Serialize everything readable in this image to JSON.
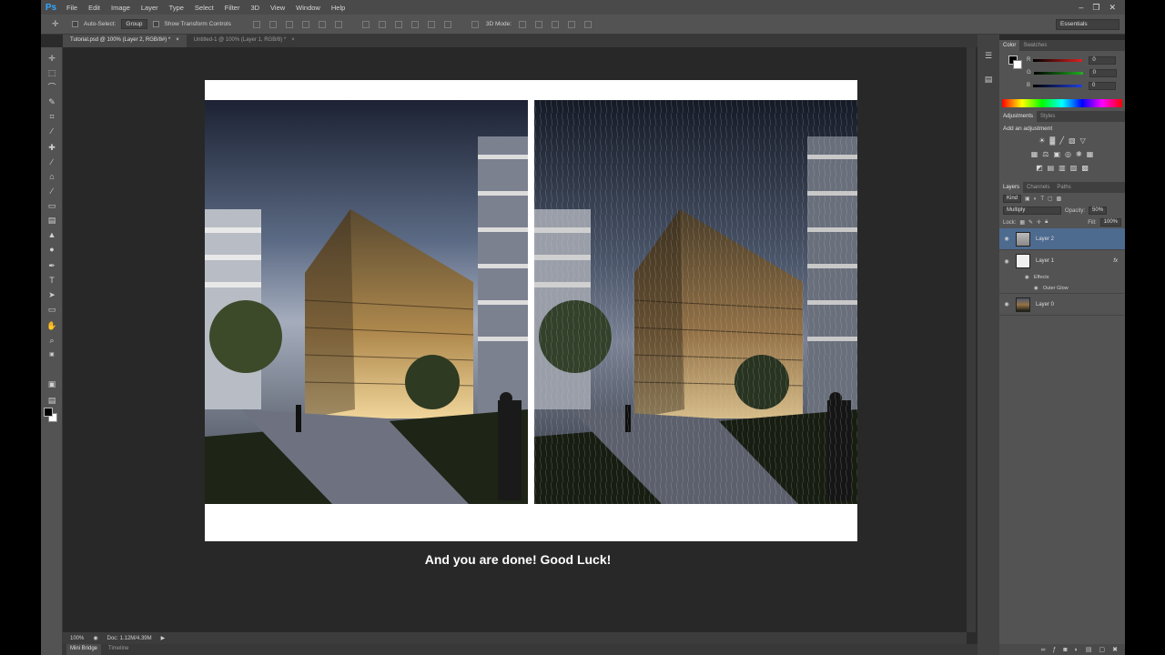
{
  "app": {
    "logo": "Ps"
  },
  "menu": [
    "File",
    "Edit",
    "Image",
    "Layer",
    "Type",
    "Select",
    "Filter",
    "3D",
    "View",
    "Window",
    "Help"
  ],
  "window_controls": {
    "minimize": "–",
    "restore": "❐",
    "close": "✕"
  },
  "options_bar": {
    "auto_select_label": "Auto-Select:",
    "auto_select_value": "Group",
    "show_transform_label": "Show Transform Controls",
    "mode_3d_label": "3D Mode:",
    "workspace": "Essentials"
  },
  "tabs": [
    {
      "label": "Tutorial.psd @ 100% (Layer 2, RGB/8#) *",
      "close": "×"
    },
    {
      "label": "Untitled-1 @ 100% (Layer 1, RGB/8) *",
      "close": "×"
    }
  ],
  "caption": "And you are done! Good Luck!",
  "status": {
    "zoom": "100%",
    "doc": "Doc: 1.12M/4.39M"
  },
  "bottom_tabs": [
    "Mini Bridge",
    "Timeline"
  ],
  "color_panel": {
    "tabs": [
      "Color",
      "Swatches"
    ],
    "channels": [
      {
        "label": "R",
        "value": "0",
        "color": "#e02020"
      },
      {
        "label": "G",
        "value": "0",
        "color": "#20b020"
      },
      {
        "label": "B",
        "value": "0",
        "color": "#2040e0"
      }
    ]
  },
  "adjustments_panel": {
    "tabs": [
      "Adjustments",
      "Styles"
    ],
    "title": "Add an adjustment"
  },
  "layers_panel": {
    "tabs": [
      "Layers",
      "Channels",
      "Paths"
    ],
    "kind": "Kind",
    "blend_mode": "Multiply",
    "opacity_label": "Opacity:",
    "opacity": "50%",
    "lock_label": "Lock:",
    "fill_label": "Fill:",
    "fill": "100%",
    "layers": [
      {
        "name": "Layer 2"
      },
      {
        "name": "Layer 1",
        "fx": "fx"
      },
      {
        "name": "Layer 0"
      }
    ],
    "effects_label": "Effects",
    "effect_name": "Outer Glow"
  },
  "colors": {
    "accent": "#31a8ff",
    "selected_layer": "#4d6a8f",
    "panel_bg": "#535353",
    "canvas_bg": "#282828"
  }
}
